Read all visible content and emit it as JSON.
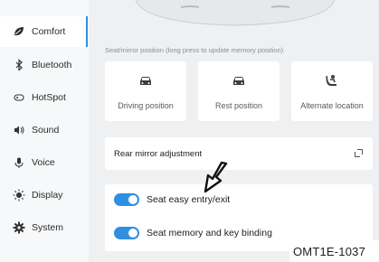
{
  "sidebar": {
    "items": [
      {
        "label": "Comfort",
        "icon": "comfort-icon",
        "active": true
      },
      {
        "label": "Bluetooth",
        "icon": "bluetooth-icon",
        "active": false
      },
      {
        "label": "HotSpot",
        "icon": "hotspot-icon",
        "active": false
      },
      {
        "label": "Sound",
        "icon": "sound-icon",
        "active": false
      },
      {
        "label": "Voice",
        "icon": "microphone-icon",
        "active": false
      },
      {
        "label": "Display",
        "icon": "brightness-icon",
        "active": false
      },
      {
        "label": "System",
        "icon": "gear-icon",
        "active": false
      }
    ]
  },
  "main": {
    "section_label": "Seat/mirror position (long press to update memory position)",
    "positions": [
      {
        "label": "Driving position",
        "icon": "car-icon"
      },
      {
        "label": "Rest position",
        "icon": "car-icon"
      },
      {
        "label": "Alternate location",
        "icon": "person-seat-icon"
      }
    ],
    "mirror_row": {
      "label": "Rear mirror adjustment",
      "icon": "open-external-icon"
    },
    "toggles": [
      {
        "label": "Seat easy entry/exit",
        "on": true
      },
      {
        "label": "Seat memory and key binding",
        "on": true
      }
    ]
  },
  "figure_code": "OMT1E-1037",
  "colors": {
    "accent": "#2f8fe0",
    "background": "#eef0f2",
    "card": "#ffffff",
    "sidebar": "#f7f8f9"
  }
}
